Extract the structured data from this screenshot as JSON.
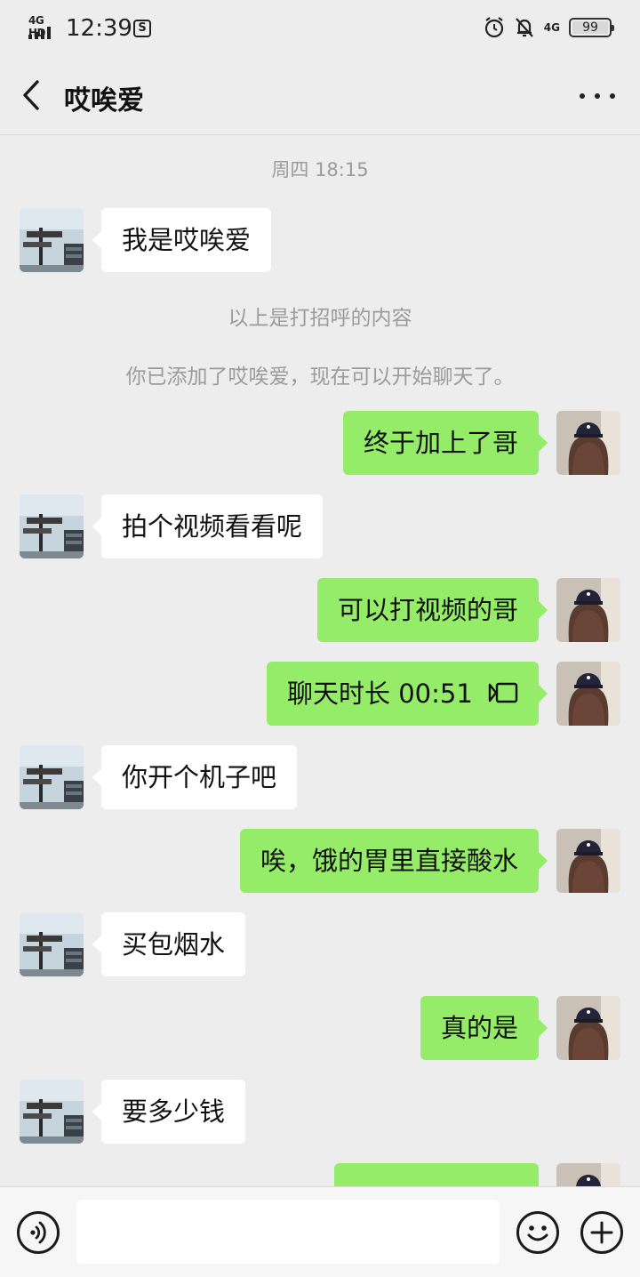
{
  "status_bar": {
    "network_label": "4G HD",
    "time": "12:39",
    "right_network": "4G",
    "battery": "99"
  },
  "header": {
    "title": "哎唉爱"
  },
  "chat": {
    "timestamp": "周四 18:15",
    "greeting_note": "以上是打招呼的内容",
    "added_note": "你已添加了哎唉爱，现在可以开始聊天了。",
    "messages": [
      {
        "side": "left",
        "text": "我是哎唉爱"
      },
      {
        "side": "right",
        "text": "终于加上了哥"
      },
      {
        "side": "left",
        "text": "拍个视频看看呢"
      },
      {
        "side": "right",
        "text": "可以打视频的哥"
      },
      {
        "side": "right",
        "text": "聊天时长 00:51"
      },
      {
        "side": "left",
        "text": "你开个机子吧"
      },
      {
        "side": "right",
        "text": "唉，饿的胃里直接酸水"
      },
      {
        "side": "left",
        "text": "买包烟水"
      },
      {
        "side": "right",
        "text": "真的是"
      },
      {
        "side": "left",
        "text": "要多少钱"
      }
    ]
  },
  "icons": {
    "back": "chevron-left-icon",
    "more": "more-dots-icon",
    "voice": "voice-icon",
    "emoji": "emoji-icon",
    "plus": "plus-icon",
    "video_call": "video-call-icon"
  },
  "colors": {
    "background": "#ededed",
    "bubble_self": "#95ec69",
    "bubble_other": "#ffffff",
    "system_text": "#9b9b9b"
  }
}
